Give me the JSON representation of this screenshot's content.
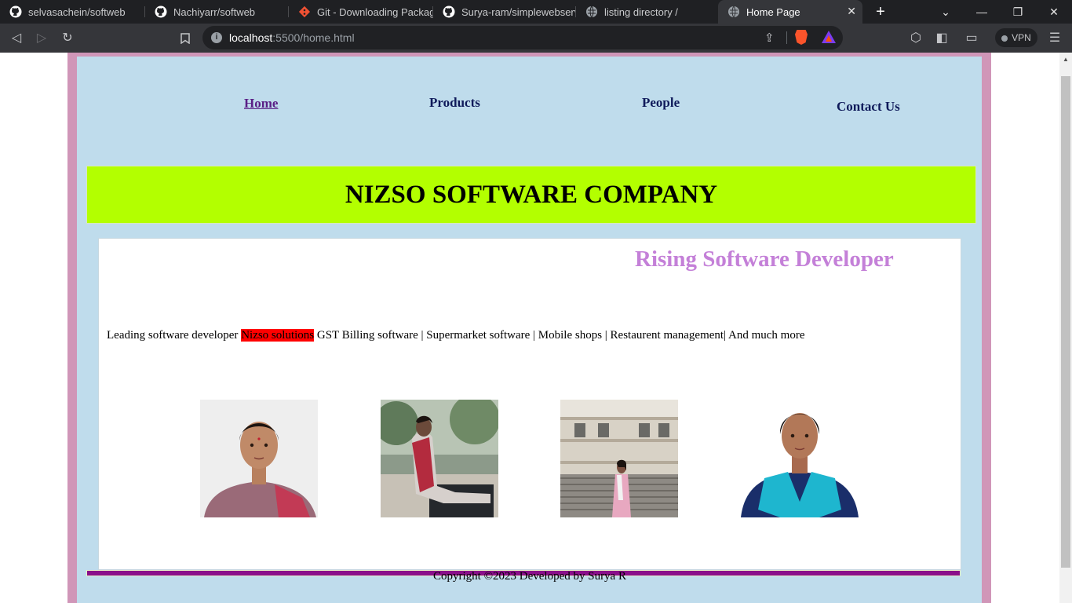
{
  "browser": {
    "tabs": [
      {
        "title": "selvasachein/softweb",
        "icon": "github-icon"
      },
      {
        "title": "Nachiyarr/softweb",
        "icon": "github-icon"
      },
      {
        "title": "Git - Downloading Package",
        "icon": "git-icon"
      },
      {
        "title": "Surya-ram/simplewebserver",
        "icon": "github-icon"
      },
      {
        "title": "listing directory /",
        "icon": "globe-icon"
      },
      {
        "title": "Home Page",
        "icon": "globe-icon",
        "active": true
      }
    ],
    "url_host": "localhost",
    "url_rest": ":5500/home.html",
    "vpn_label": "VPN"
  },
  "nav": {
    "items": [
      {
        "label": "Home",
        "current": true
      },
      {
        "label": "Products"
      },
      {
        "label": "People"
      },
      {
        "label": "Contact Us"
      }
    ]
  },
  "banner": {
    "title": "NIZSO SOFTWARE COMPANY"
  },
  "content": {
    "tagline": "Rising Software Developer",
    "services_prefix": "Leading software developer ",
    "services_highlight": "Nizso solutions",
    "services_rest": " GST Billing software | Supermarket software | Mobile shops | Restaurent management| And much more"
  },
  "footer": {
    "text": "Copyright ©2023 Developed by Surya R"
  },
  "colors": {
    "frame": "#d096b8",
    "page_bg": "#bfdcec",
    "banner_bg": "#b3ff00",
    "tagline": "#c480d8",
    "highlight": "#ff0000",
    "footer_line": "#8a0f8a"
  }
}
